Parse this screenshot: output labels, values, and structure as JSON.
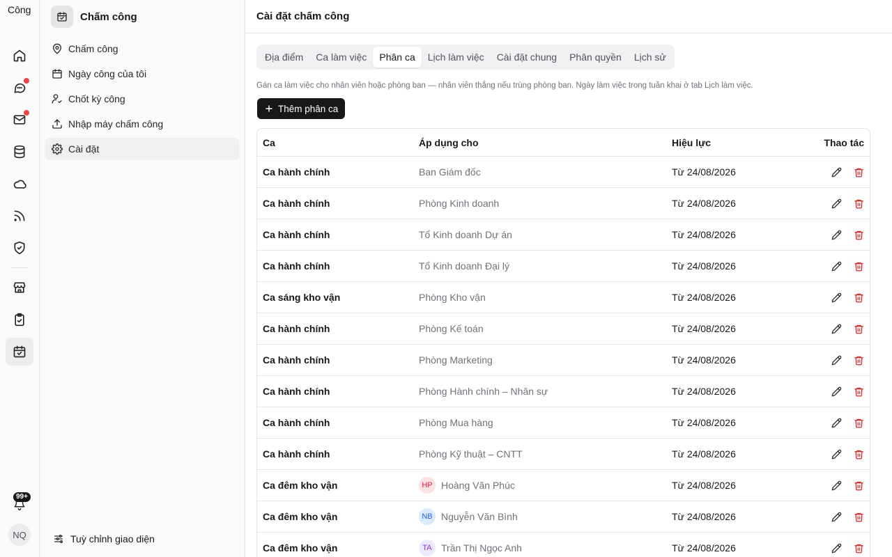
{
  "app": {
    "logo_text": "Công",
    "notification_badge": "99+",
    "user_initials": "NQ"
  },
  "sidebar": {
    "title": "Chấm công",
    "items": [
      {
        "label": "Chấm công",
        "icon": "map-pin-icon"
      },
      {
        "label": "Ngày công của tôi",
        "icon": "calendar-icon"
      },
      {
        "label": "Chốt kỳ công",
        "icon": "user-check-icon"
      },
      {
        "label": "Nhập máy chấm công",
        "icon": "upload-icon"
      },
      {
        "label": "Cài đặt",
        "icon": "gear-icon"
      }
    ],
    "footer_label": "Tuỳ chỉnh giao diện"
  },
  "page": {
    "title": "Cài đặt chấm công",
    "tabs": [
      "Địa điểm",
      "Ca làm việc",
      "Phân ca",
      "Lịch làm việc",
      "Cài đặt chung",
      "Phân quyền",
      "Lịch sử"
    ],
    "active_tab": "Phân ca",
    "hint": "Gán ca làm việc cho nhân viên hoặc phòng ban — nhân viên thắng nếu trùng phòng ban. Ngày làm việc trong tuần khai ở tab Lịch làm việc.",
    "add_button": "Thêm phân ca"
  },
  "table": {
    "headers": {
      "ca": "Ca",
      "apply": "Áp dụng cho",
      "effective": "Hiệu lực",
      "actions": "Thao tác"
    },
    "rows": [
      {
        "ca": "Ca hành chính",
        "apply": "Ban Giám đốc",
        "effective": "Từ 24/08/2026"
      },
      {
        "ca": "Ca hành chính",
        "apply": "Phòng Kinh doanh",
        "effective": "Từ 24/08/2026"
      },
      {
        "ca": "Ca hành chính",
        "apply": "Tổ Kinh doanh Dự án",
        "effective": "Từ 24/08/2026"
      },
      {
        "ca": "Ca hành chính",
        "apply": "Tổ Kinh doanh Đại lý",
        "effective": "Từ 24/08/2026"
      },
      {
        "ca": "Ca sáng kho vận",
        "apply": "Phòng Kho vận",
        "effective": "Từ 24/08/2026"
      },
      {
        "ca": "Ca hành chính",
        "apply": "Phòng Kế toán",
        "effective": "Từ 24/08/2026"
      },
      {
        "ca": "Ca hành chính",
        "apply": "Phòng Marketing",
        "effective": "Từ 24/08/2026"
      },
      {
        "ca": "Ca hành chính",
        "apply": "Phòng Hành chính – Nhân sự",
        "effective": "Từ 24/08/2026"
      },
      {
        "ca": "Ca hành chính",
        "apply": "Phòng Mua hàng",
        "effective": "Từ 24/08/2026"
      },
      {
        "ca": "Ca hành chính",
        "apply": "Phòng Kỹ thuật – CNTT",
        "effective": "Từ 24/08/2026"
      },
      {
        "ca": "Ca đêm kho vận",
        "apply": "Hoàng Văn Phúc",
        "initials": "HP",
        "effective": "Từ 24/08/2026"
      },
      {
        "ca": "Ca đêm kho vận",
        "apply": "Nguyễn Văn Bình",
        "initials": "NB",
        "effective": "Từ 24/08/2026"
      },
      {
        "ca": "Ca đêm kho vận",
        "apply": "Trần Thị Ngọc Anh",
        "initials": "TA",
        "effective": "Từ 24/08/2026"
      }
    ]
  },
  "colors": {
    "delete": "#dc2626",
    "dot": "#ef4444",
    "primary_button": "#18181b"
  }
}
